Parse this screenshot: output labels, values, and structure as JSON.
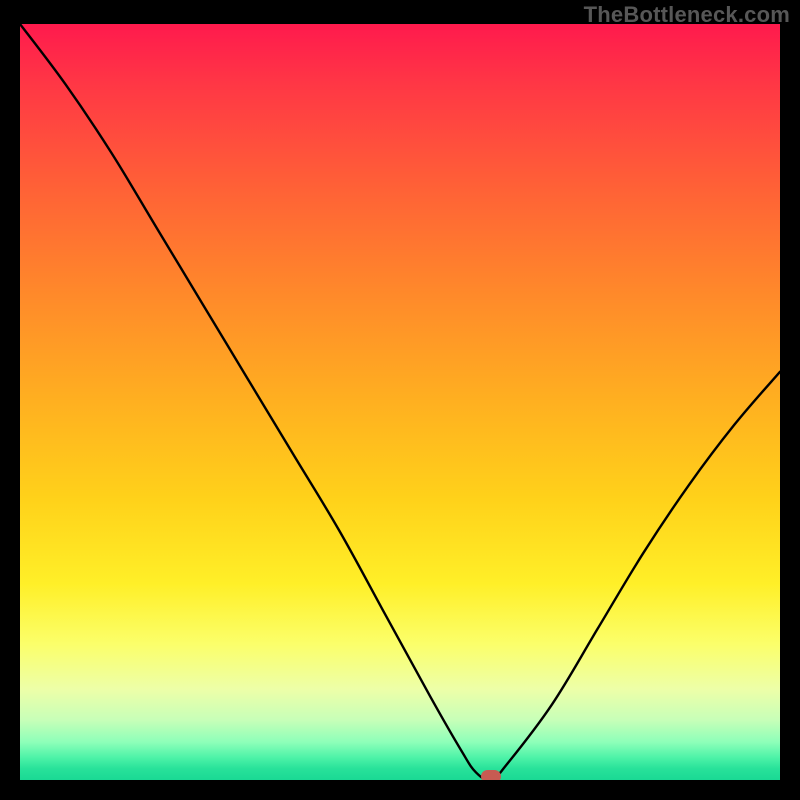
{
  "watermark": "TheBottleneck.com",
  "colors": {
    "page_bg": "#000000",
    "watermark_text": "#575757",
    "curve": "#000000",
    "marker": "#c75b52"
  },
  "chart_data": {
    "type": "line",
    "title": "",
    "xlabel": "",
    "ylabel": "",
    "xlim": [
      0,
      100
    ],
    "ylim": [
      0,
      100
    ],
    "grid": false,
    "legend": false,
    "series": [
      {
        "name": "bottleneck-curve",
        "x": [
          0,
          6,
          12,
          18,
          24,
          30,
          36,
          42,
          48,
          54,
          58,
          60,
          62,
          64,
          70,
          76,
          82,
          88,
          94,
          100
        ],
        "y": [
          100,
          92,
          83,
          73,
          63,
          53,
          43,
          33,
          22,
          11,
          4,
          1,
          0,
          2,
          10,
          20,
          30,
          39,
          47,
          54
        ]
      }
    ],
    "annotations": [
      {
        "name": "marker-dot",
        "x": 62,
        "y": 0
      }
    ],
    "background_gradient_stops": [
      {
        "pos": 0,
        "color": "#ff1a4d"
      },
      {
        "pos": 50,
        "color": "#ffb020"
      },
      {
        "pos": 82,
        "color": "#fbff6a"
      },
      {
        "pos": 100,
        "color": "#1ad994"
      }
    ]
  }
}
